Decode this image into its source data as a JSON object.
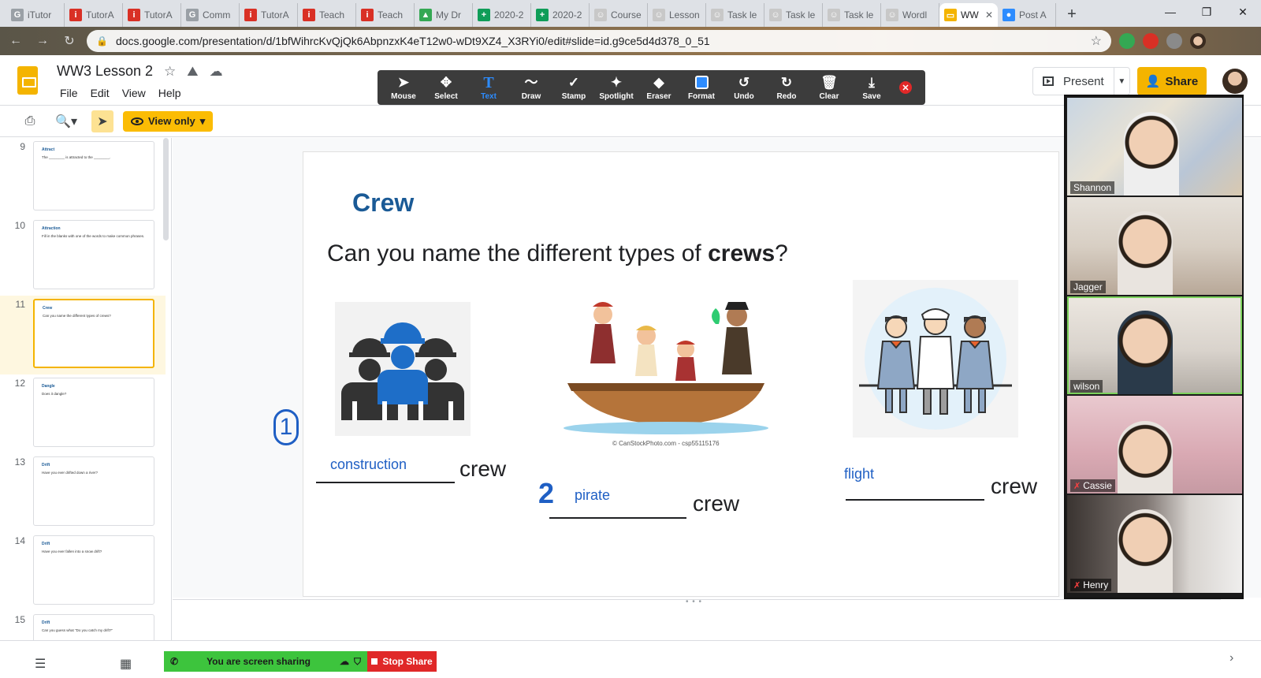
{
  "browser": {
    "tabs": [
      {
        "label": "iTutor",
        "fav": "G",
        "color": "#9aa0a6"
      },
      {
        "label": "TutorA",
        "fav": "i",
        "color": "#d93025"
      },
      {
        "label": "TutorA",
        "fav": "i",
        "color": "#d93025"
      },
      {
        "label": "Comm",
        "fav": "G",
        "color": "#9aa0a6"
      },
      {
        "label": "TutorA",
        "fav": "i",
        "color": "#d93025"
      },
      {
        "label": "Teach",
        "fav": "i",
        "color": "#d93025"
      },
      {
        "label": "Teach",
        "fav": "i",
        "color": "#d93025"
      },
      {
        "label": "My Dr",
        "fav": "▲",
        "color": "#34a853"
      },
      {
        "label": "2020-2",
        "fav": "+",
        "color": "#0f9d58"
      },
      {
        "label": "2020-2",
        "fav": "+",
        "color": "#0f9d58"
      },
      {
        "label": "Course",
        "fav": "☺",
        "color": "#c8c8c8"
      },
      {
        "label": "Lesson",
        "fav": "☺",
        "color": "#c8c8c8"
      },
      {
        "label": "Task le",
        "fav": "☺",
        "color": "#c8c8c8"
      },
      {
        "label": "Task le",
        "fav": "☺",
        "color": "#c8c8c8"
      },
      {
        "label": "Task le",
        "fav": "☺",
        "color": "#c8c8c8"
      },
      {
        "label": "Wordl",
        "fav": "☺",
        "color": "#c8c8c8"
      },
      {
        "label": "WW",
        "fav": "▭",
        "color": "#f4b400",
        "active": true
      },
      {
        "label": "Post A",
        "fav": "●",
        "color": "#2d8cff"
      }
    ],
    "url": "docs.google.com/presentation/d/1bfWihrcKvQjQk6AbpnzxK4eT12w0-wDt9XZ4_X3RYi0/edit#slide=id.g9ce5d4d378_0_51"
  },
  "doc": {
    "title": "WW3 Lesson 2",
    "menus": [
      "File",
      "Edit",
      "View",
      "Help"
    ],
    "present_label": "Present",
    "share_label": "Share",
    "view_only_label": "View only"
  },
  "annotation_toolbar": {
    "tools": [
      {
        "label": "Mouse",
        "icon": "mouse-pointer-icon",
        "glyph": "➤"
      },
      {
        "label": "Select",
        "icon": "select-move-icon",
        "glyph": "✥"
      },
      {
        "label": "Text",
        "icon": "text-t-icon",
        "glyph": "T"
      },
      {
        "label": "Draw",
        "icon": "draw-wave-icon",
        "glyph": "〜"
      },
      {
        "label": "Stamp",
        "icon": "stamp-check-icon",
        "glyph": "✓"
      },
      {
        "label": "Spotlight",
        "icon": "spotlight-wand-icon",
        "glyph": "✦"
      },
      {
        "label": "Eraser",
        "icon": "eraser-icon",
        "glyph": "◆"
      },
      {
        "label": "Format",
        "icon": "format-swatch-icon",
        "glyph": ""
      },
      {
        "label": "Undo",
        "icon": "undo-icon",
        "glyph": "↺"
      },
      {
        "label": "Redo",
        "icon": "redo-icon",
        "glyph": "↻"
      },
      {
        "label": "Clear",
        "icon": "trash-icon",
        "glyph": "🗑"
      },
      {
        "label": "Save",
        "icon": "save-download-icon",
        "glyph": "⤓"
      }
    ]
  },
  "filmstrip": [
    {
      "num": "9",
      "title": "Attract",
      "sub": "The ________ is attracted to the ________."
    },
    {
      "num": "10",
      "title": "Attraction",
      "sub": "Fill in the blanks with one of the words to make common phrases."
    },
    {
      "num": "11",
      "title": "Crew",
      "sub": "Can you name the different types of crews?",
      "selected": true
    },
    {
      "num": "12",
      "title": "Dangle",
      "sub": "Does it dangle?"
    },
    {
      "num": "13",
      "title": "Drift",
      "sub": "Have you ever drifted down a river?"
    },
    {
      "num": "14",
      "title": "Drift",
      "sub": "Have you ever fallen into a snow drift?"
    },
    {
      "num": "15",
      "title": "Drift",
      "sub": "Can you guess what \"Do you catch my drift?\""
    }
  ],
  "slide": {
    "title": "Crew",
    "question_pre": "Can you name the different types of ",
    "question_bold": "crews",
    "question_post": "?",
    "crew_word": "crew",
    "answers": [
      "construction",
      "pirate",
      "flight"
    ],
    "ink_numbers": [
      "1",
      "2"
    ],
    "image_caption": "© CanStockPhoto.com - csp55115176"
  },
  "zoom": {
    "sharing_label": "You are screen sharing",
    "stop_share_label": "Stop Share",
    "participants": [
      {
        "name": "Shannon",
        "muted": false
      },
      {
        "name": "Jagger",
        "muted": false
      },
      {
        "name": "wilson",
        "muted": false,
        "active": true
      },
      {
        "name": "Cassie",
        "muted": true
      },
      {
        "name": "Henry",
        "muted": true
      }
    ]
  }
}
